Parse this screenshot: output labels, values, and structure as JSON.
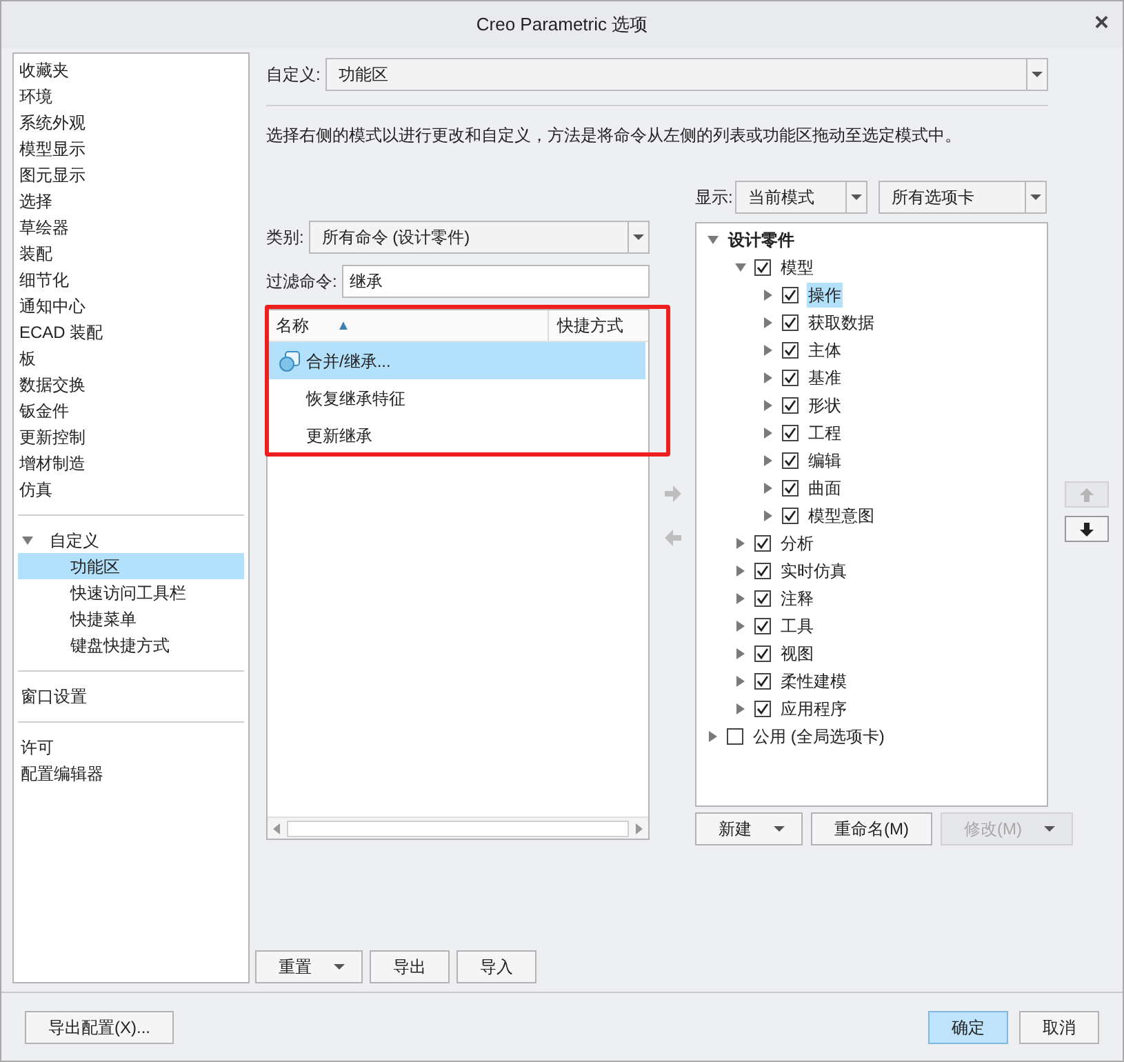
{
  "window": {
    "title": "Creo Parametric 选项",
    "close": "×"
  },
  "sidebar": {
    "groups": [
      {
        "items": [
          {
            "label": "收藏夹",
            "selected": false
          },
          {
            "label": "环境",
            "selected": false
          },
          {
            "label": "系统外观",
            "selected": false
          },
          {
            "label": "模型显示",
            "selected": false
          },
          {
            "label": "图元显示",
            "selected": false
          },
          {
            "label": "选择",
            "selected": false
          },
          {
            "label": "草绘器",
            "selected": false
          },
          {
            "label": "装配",
            "selected": false
          },
          {
            "label": "细节化",
            "selected": false
          },
          {
            "label": "通知中心",
            "selected": false
          },
          {
            "label": "ECAD 装配",
            "selected": false
          },
          {
            "label": "板",
            "selected": false
          },
          {
            "label": "数据交换",
            "selected": false
          },
          {
            "label": "钣金件",
            "selected": false
          },
          {
            "label": "更新控制",
            "selected": false
          },
          {
            "label": "增材制造",
            "selected": false
          },
          {
            "label": "仿真",
            "selected": false
          }
        ]
      },
      {
        "items": [
          {
            "label": "自定义",
            "selected": false,
            "expanded": true,
            "children": [
              {
                "label": "功能区",
                "selected": true
              },
              {
                "label": "快速访问工具栏",
                "selected": false
              },
              {
                "label": "快捷菜单",
                "selected": false
              },
              {
                "label": "键盘快捷方式",
                "selected": false
              }
            ]
          }
        ]
      },
      {
        "items": [
          {
            "label": "窗口设置",
            "selected": false
          }
        ]
      },
      {
        "items": [
          {
            "label": "许可",
            "selected": false
          },
          {
            "label": "配置编辑器",
            "selected": false
          }
        ]
      }
    ]
  },
  "customize": {
    "label": "自定义:",
    "value": "功能区"
  },
  "description": "选择右侧的模式以进行更改和自定义，方法是将命令从左侧的列表或功能区拖动至选定模式中。",
  "category": {
    "label": "类别:",
    "value": "所有命令 (设计零件)"
  },
  "filter": {
    "label": "过滤命令:",
    "value": "继承"
  },
  "command_list": {
    "highlighted": true,
    "columns": [
      {
        "label": "名称",
        "sort": "▲"
      },
      {
        "label": "快捷方式"
      }
    ],
    "rows": [
      {
        "name": "合并/继承...",
        "has_icon": true,
        "selected": true
      },
      {
        "name": "恢复继承特征",
        "has_icon": false,
        "selected": false
      },
      {
        "name": "更新继承",
        "has_icon": false,
        "selected": false
      }
    ]
  },
  "left_buttons": [
    {
      "label": "重置",
      "kind": "split"
    },
    {
      "label": "导出",
      "kind": "plain"
    },
    {
      "label": "导入",
      "kind": "plain"
    }
  ],
  "display": {
    "label": "显示:",
    "mode": "当前模式",
    "tabs": "所有选项卡"
  },
  "tree": [
    {
      "label": "设计零件",
      "kind": "root",
      "expanded": true,
      "selected": false,
      "children": [
        {
          "label": "模型",
          "kind": "check",
          "checked": true,
          "expanded": true,
          "selected": false,
          "children": [
            {
              "label": "操作",
              "kind": "check",
              "checked": true,
              "expanded": false,
              "selected": true
            },
            {
              "label": "获取数据",
              "kind": "check",
              "checked": true,
              "expanded": false,
              "selected": false
            },
            {
              "label": "主体",
              "kind": "check",
              "checked": true,
              "expanded": false,
              "selected": false
            },
            {
              "label": "基准",
              "kind": "check",
              "checked": true,
              "expanded": false,
              "selected": false
            },
            {
              "label": "形状",
              "kind": "check",
              "checked": true,
              "expanded": false,
              "selected": false
            },
            {
              "label": "工程",
              "kind": "check",
              "checked": true,
              "expanded": false,
              "selected": false
            },
            {
              "label": "编辑",
              "kind": "check",
              "checked": true,
              "expanded": false,
              "selected": false
            },
            {
              "label": "曲面",
              "kind": "check",
              "checked": true,
              "expanded": false,
              "selected": false
            },
            {
              "label": "模型意图",
              "kind": "check",
              "checked": true,
              "expanded": false,
              "selected": false
            }
          ]
        },
        {
          "label": "分析",
          "kind": "check",
          "checked": true,
          "expanded": false,
          "selected": false
        },
        {
          "label": "实时仿真",
          "kind": "check",
          "checked": true,
          "expanded": false,
          "selected": false
        },
        {
          "label": "注释",
          "kind": "check",
          "checked": true,
          "expanded": false,
          "selected": false
        },
        {
          "label": "工具",
          "kind": "check",
          "checked": true,
          "expanded": false,
          "selected": false
        },
        {
          "label": "视图",
          "kind": "check",
          "checked": true,
          "expanded": false,
          "selected": false
        },
        {
          "label": "柔性建模",
          "kind": "check",
          "checked": true,
          "expanded": false,
          "selected": false
        },
        {
          "label": "应用程序",
          "kind": "check",
          "checked": true,
          "expanded": false,
          "selected": false
        }
      ]
    },
    {
      "label": "公用 (全局选项卡)",
      "kind": "check",
      "checked": false,
      "expanded": false,
      "selected": false
    }
  ],
  "tree_buttons": [
    {
      "label": "新建",
      "kind": "split",
      "disabled": false
    },
    {
      "label": "重命名(M)",
      "kind": "plain",
      "disabled": false
    },
    {
      "label": "修改(M)",
      "kind": "split",
      "disabled": true
    }
  ],
  "footer": {
    "export_config": "导出配置(X)...",
    "buttons": [
      {
        "label": "确定",
        "kind": "primary"
      },
      {
        "label": "取消",
        "kind": "plain"
      }
    ]
  }
}
